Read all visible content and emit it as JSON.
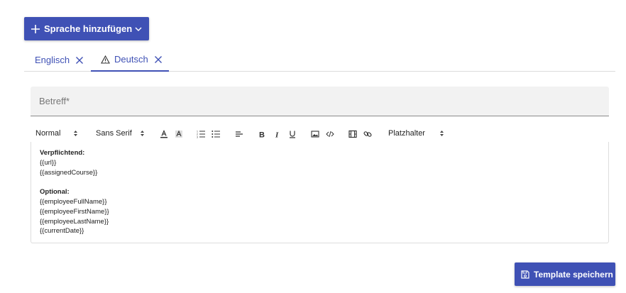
{
  "add_language": {
    "label": "Sprache hinzufügen"
  },
  "tabs": [
    {
      "label": "Englisch",
      "warning": false
    },
    {
      "label": "Deutsch",
      "warning": true
    }
  ],
  "subject": {
    "placeholder": "Betreff*",
    "value": ""
  },
  "toolbar": {
    "format": "Normal",
    "font": "Sans Serif",
    "placeholder_select": "Platzhalter"
  },
  "editor": {
    "required_heading": "Verpflichtend:",
    "required_items": [
      "{{url}}",
      "{{assignedCourse}}"
    ],
    "optional_heading": "Optional:",
    "optional_items": [
      "{{employeeFullName}}",
      "{{employeeFirstName}}",
      "{{employeeLastName}}",
      "{{currentDate}}"
    ]
  },
  "save_button": {
    "label": "Template speichern"
  },
  "colors": {
    "primary": "#3f51b5",
    "field_bg": "#f2f2f2"
  }
}
